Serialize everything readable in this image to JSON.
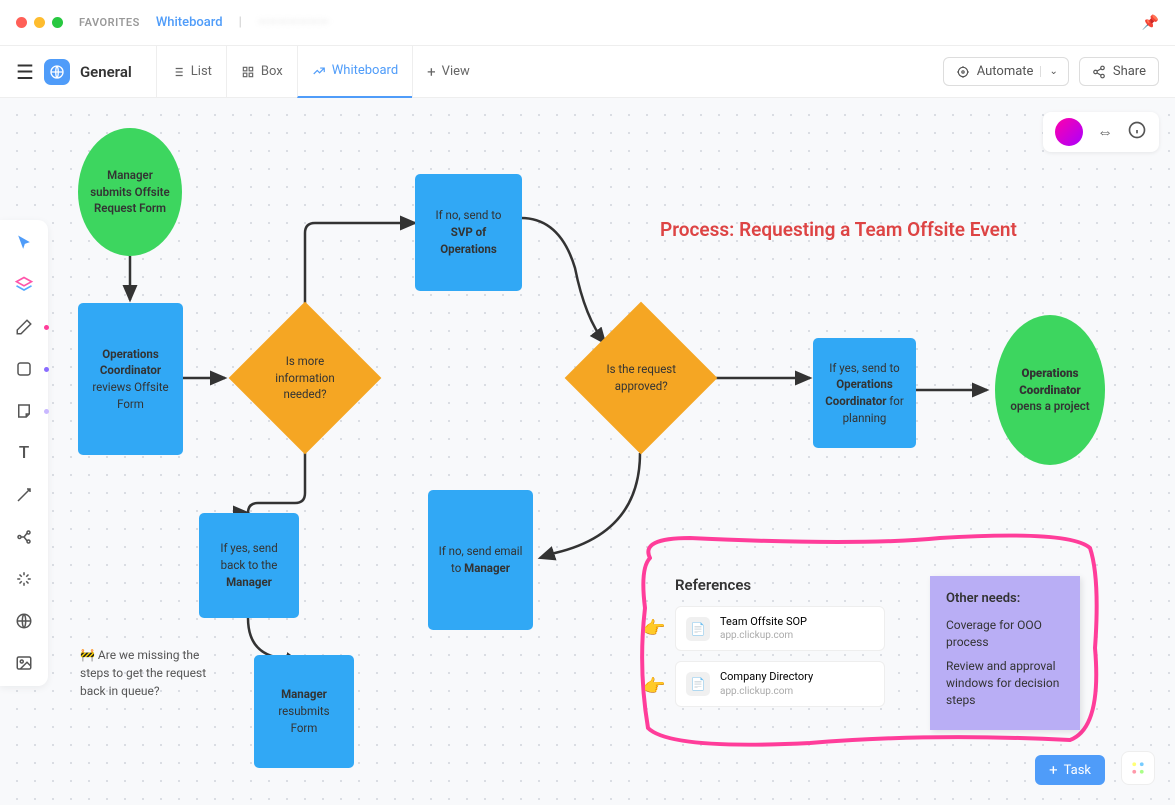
{
  "topbar": {
    "favorites": "FAVORITES",
    "crumb1": "Whiteboard",
    "crumb2": "———————"
  },
  "header": {
    "title": "General",
    "tabs": [
      "List",
      "Box",
      "Whiteboard"
    ],
    "view": "View",
    "automate": "Automate",
    "share": "Share"
  },
  "sidebar": {
    "items": [
      "cursor",
      "layers",
      "pen",
      "shape",
      "note",
      "text",
      "connector",
      "mindmap",
      "sparkle",
      "embed",
      "image"
    ]
  },
  "process_title": "Process: Requesting a Team Offsite Event",
  "nodes": {
    "start": "Manager submits Offsite Request Form",
    "review": {
      "l1": "Operations Coordinator",
      "l2": "reviews Offsite Form"
    },
    "d1": "Is more information needed?",
    "svp": {
      "l1": "If no, send to",
      "l2": "SVP of Operations"
    },
    "back": {
      "l1": "If yes, send back to the",
      "l2": "Manager"
    },
    "resub": {
      "l1": "Manager",
      "l2": "resubmits Form"
    },
    "d2": "Is the request approved?",
    "email": {
      "l1": "If no, send email to",
      "l2": "Manager"
    },
    "plan": {
      "l1": "If yes, send to",
      "l2": "Operations Coordinator",
      "l3": "for planning"
    },
    "end": {
      "l1": "Operations Coordinator",
      "l2": "opens a project"
    }
  },
  "comment": "🚧 Are we missing the steps to get the request back in queue?",
  "refs": {
    "title": "References",
    "items": [
      {
        "title": "Team Offsite SOP",
        "sub": "app.clickup.com"
      },
      {
        "title": "Company Directory",
        "sub": "app.clickup.com"
      }
    ]
  },
  "sticky": {
    "title": "Other needs:",
    "items": [
      "Coverage for OOO process",
      "Review and approval windows for decision steps"
    ]
  },
  "buttons": {
    "task": "Task"
  }
}
